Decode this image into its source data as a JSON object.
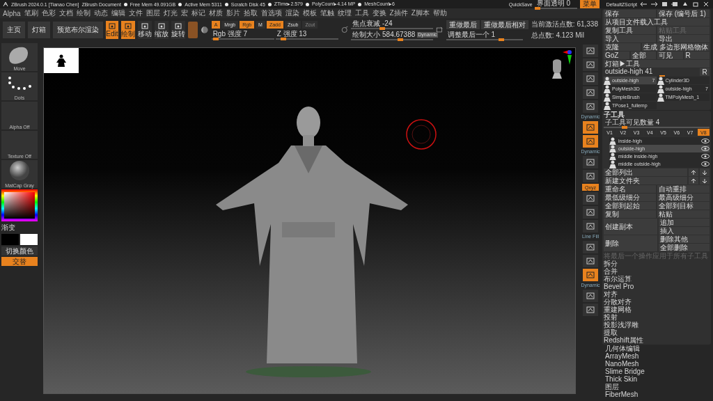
{
  "title_bar": {
    "app": "ZBrush 2024.0.1 [Tianao Chen]",
    "document": "ZBrush Document",
    "stats": [
      "Free Mem 49.091GB",
      "Active Mem 5311",
      "Scratch Disk 45",
      "ZTime▸2.579",
      "PolyCount▸4.14 MP",
      "MeshCount▸6"
    ],
    "quicksave": "QuickSave",
    "transparency": {
      "label": "界面透明 0",
      "level": 0.05
    },
    "menu_button": {
      "label": "菜单",
      "on": true
    },
    "script": "DefaultZScript"
  },
  "menu_bar": [
    "Alpha",
    "笔刷",
    "色彩",
    "文档",
    "绘制",
    "动态",
    "编辑",
    "文件",
    "图层",
    "灯光",
    "宏",
    "标记",
    "材质",
    "影片",
    "拾取",
    "首选项",
    "渲染",
    "模板",
    "笔触",
    "纹理",
    "工具",
    "变换",
    "Z插件",
    "Z脚本",
    "帮助"
  ],
  "toolbar": {
    "nav_buttons": [
      "主页",
      "灯箱",
      "预览布尔渲染"
    ],
    "transform_tools": [
      {
        "label": "Edit",
        "selected": true
      },
      {
        "label": "绘制",
        "selected": true
      },
      {
        "label": "移动",
        "selected": false
      },
      {
        "label": "缩放",
        "selected": false
      },
      {
        "label": "旋转",
        "selected": false
      }
    ],
    "modes": [
      {
        "label": "A",
        "selected": true,
        "disabled": false
      },
      {
        "label": "Mrgb",
        "selected": false,
        "disabled": false
      },
      {
        "label": "Rgb",
        "selected": true,
        "disabled": false
      },
      {
        "label": "M",
        "selected": false,
        "disabled": false
      },
      {
        "label": "Zadd",
        "selected": true,
        "disabled": false
      },
      {
        "label": "Zsub",
        "selected": false,
        "disabled": false
      },
      {
        "label": "Zcut",
        "selected": false,
        "disabled": true
      }
    ],
    "intensity_sliders": [
      {
        "label": "Rgb 强度 7",
        "level": 0.07
      },
      {
        "label": "Z 强度 13",
        "level": 0.13
      }
    ],
    "draw_sliders": [
      {
        "label": "焦点衰减 -24",
        "level": 0.38
      },
      {
        "label": "绘制大小 584.67388",
        "level": 0.6,
        "badge": "Dynamic"
      }
    ],
    "redo_buttons": [
      "重做最后",
      "重做最后相对"
    ],
    "adjust_slider": {
      "label": "调整最后一个 1",
      "level": 0.72
    },
    "point_counts": [
      "当前激活点数: 61,338",
      "总点数: 4.123 Mil"
    ]
  },
  "left_shelf": {
    "thumbnails": [
      {
        "label": "Move",
        "kind": "brush"
      },
      {
        "label": "Dots",
        "kind": "stroke"
      },
      {
        "label": "Alpha Off",
        "kind": "empty"
      },
      {
        "label": "Texture Off",
        "kind": "empty"
      },
      {
        "label": "MatCap Gray",
        "kind": "sphere"
      }
    ],
    "gradient_label": "渐变",
    "switch_color": "切换颜色",
    "alternate": {
      "label": "交替",
      "on": true
    }
  },
  "right_strip": [
    {
      "kind": "icon",
      "selected": false
    },
    {
      "kind": "icon",
      "selected": false
    },
    {
      "kind": "icon",
      "selected": false
    },
    {
      "kind": "icon",
      "selected": false
    },
    {
      "kind": "icon",
      "selected": false
    },
    {
      "kind": "label",
      "text": "Dynamic"
    },
    {
      "kind": "icon",
      "selected": true
    },
    {
      "kind": "icon",
      "selected": true
    },
    {
      "kind": "label",
      "text": "Dynamic"
    },
    {
      "kind": "icon",
      "selected": false
    },
    {
      "kind": "icon",
      "selected": false
    },
    {
      "kind": "toggle",
      "text": "Qxyz",
      "selected": true
    },
    {
      "kind": "icon",
      "selected": false
    },
    {
      "kind": "icon",
      "selected": false
    },
    {
      "kind": "icon",
      "selected": false
    },
    {
      "kind": "label",
      "text": "Line Fill"
    },
    {
      "kind": "icon",
      "selected": false
    },
    {
      "kind": "icon",
      "selected": false
    },
    {
      "kind": "icon",
      "selected": true
    },
    {
      "kind": "label",
      "text": "Dynamic"
    },
    {
      "kind": "icon",
      "selected": false
    },
    {
      "kind": "icon",
      "selected": false
    }
  ],
  "right_panel": {
    "tool_rows": [
      [
        {
          "label": "保存",
          "disabled": false
        },
        {
          "label": "保存 (编号后 1)",
          "disabled": false
        }
      ],
      [
        {
          "label": "从项目文件载入工具",
          "disabled": false
        }
      ],
      [
        {
          "label": "复制工具",
          "disabled": false
        },
        {
          "label": "粘贴工具",
          "disabled": true
        }
      ],
      [
        {
          "label": "导入",
          "disabled": false
        },
        {
          "label": "导出",
          "disabled": false
        }
      ],
      [
        {
          "label": "克隆",
          "disabled": false
        },
        {
          "label": "生成 多边形网格物体",
          "disabled": false
        }
      ],
      [
        {
          "label": "GoZ",
          "disabled": false
        },
        {
          "label": "全部",
          "disabled": false
        },
        {
          "label": "可见",
          "disabled": false
        },
        {
          "label": "R",
          "disabled": false
        }
      ],
      [
        {
          "label": "灯箱▶工具",
          "disabled": false
        }
      ]
    ],
    "tool_slider": {
      "label": "outside-high 41",
      "level": 0.62,
      "button": "R"
    },
    "tools": [
      {
        "label": "outside-high",
        "count": "7",
        "selected": true
      },
      {
        "label": "Cylinder3D",
        "selected": false
      },
      {
        "label": "PolyMesh3D",
        "selected": false
      },
      {
        "label": "outside-high",
        "count": "7",
        "selected": false
      },
      {
        "label": "SimpleBrush",
        "selected": false
      },
      {
        "label": "TMPolyMesh_1",
        "selected": false
      },
      {
        "label": "TPose1_fullemp",
        "selected": false
      }
    ],
    "subtool": {
      "title": "子工具",
      "visible_count": {
        "label": "子工具可见数量 4",
        "level": 0.2
      },
      "versions": [
        {
          "label": "V1",
          "selected": false
        },
        {
          "label": "V2",
          "selected": false
        },
        {
          "label": "V3",
          "selected": false
        },
        {
          "label": "V4",
          "selected": false
        },
        {
          "label": "V5",
          "selected": false
        },
        {
          "label": "V6",
          "selected": false
        },
        {
          "label": "V7",
          "selected": false
        },
        {
          "label": "V8",
          "selected": true
        }
      ],
      "items": [
        {
          "name": "inside-high",
          "selected": false
        },
        {
          "name": "outside-high",
          "selected": true
        },
        {
          "name": "middle inside-high",
          "selected": false
        },
        {
          "name": "middle outside-high",
          "selected": false
        }
      ],
      "list_all": "全部列出",
      "new_folder": "新建文件夹",
      "action_rows": [
        [
          {
            "label": "重命名",
            "disabled": false
          },
          {
            "label": "自动重排",
            "disabled": false
          }
        ],
        [
          {
            "label": "最低级细分",
            "disabled": false
          },
          {
            "label": "最高级细分",
            "disabled": false
          }
        ],
        [
          {
            "label": "全部到起始",
            "disabled": false
          },
          {
            "label": "全部到目标",
            "disabled": false
          }
        ],
        [
          {
            "label": "复制",
            "disabled": false
          },
          {
            "label": "粘贴",
            "disabled": false
          }
        ]
      ],
      "stack_groups": [
        {
          "main": "创建副本",
          "options": [
            "追加",
            "插入"
          ]
        },
        {
          "main": "删除",
          "options": [
            "删除其他",
            "全部删除"
          ]
        }
      ],
      "note": "将最后一个操作应用于所有子工具",
      "sections": [
        "拆分",
        "合并",
        "布尔运算",
        "Bevel Pro",
        "对齐",
        "分散对齐",
        "重建网格",
        "投射",
        "投影浅浮雕",
        "提取",
        "Redshift属性"
      ]
    },
    "geometry": [
      "几何体编辑",
      "ArrayMesh",
      "NanoMesh",
      "Slime Bridge",
      "Thick Skin",
      "图层",
      "FiberMesh"
    ]
  }
}
